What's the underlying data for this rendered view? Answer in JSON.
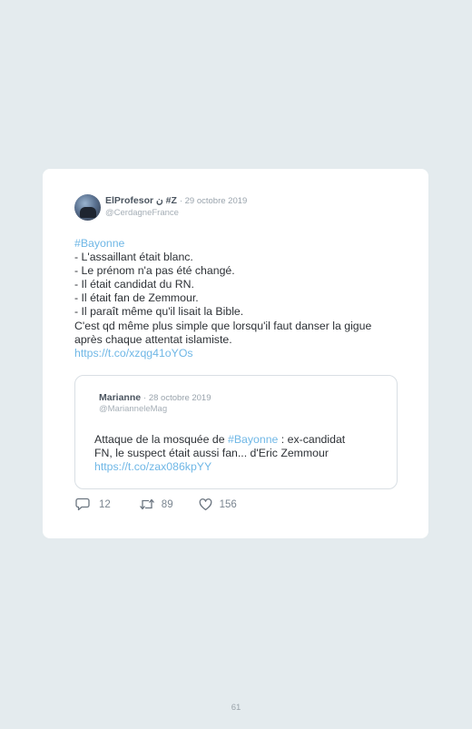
{
  "tweet": {
    "author_name": "ElProfesor ن #Z",
    "date": "· 29 octobre 2019",
    "handle": "@CerdagneFrance",
    "hashtag": "#Bayonne",
    "lines": [
      "- L'assaillant était blanc.",
      "- Le prénom n'a pas été changé.",
      "- Il était candidat du RN.",
      "- Il était fan de Zemmour.",
      "- Il paraît même qu'il lisait la Bible.",
      "C'est qd même plus simple que lorsqu'il faut danser la gigue",
      "après chaque attentat islamiste."
    ],
    "link": "https://t.co/xzqg41oYOs"
  },
  "quoted": {
    "author_name": "Marianne",
    "date": "· 28 octobre 2019",
    "handle": "@MarianneleMag",
    "text_before": "Attaque de la mosquée de ",
    "hashtag": "#Bayonne",
    "text_after": " : ex-candidat",
    "line2": "FN, le suspect était aussi fan... d'Eric Zemmour",
    "link": "https://t.co/zax086kpYY"
  },
  "actions": {
    "replies": "12",
    "retweets": "89",
    "likes": "156"
  },
  "page_number": "61",
  "colors": {
    "background": "#e4ebee",
    "card": "#ffffff",
    "link": "#6fb7e6"
  }
}
